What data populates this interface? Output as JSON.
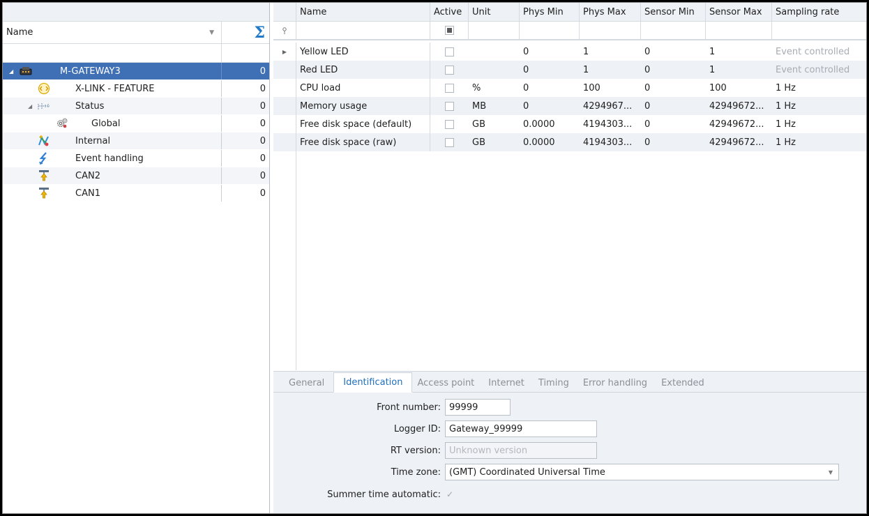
{
  "tree": {
    "header": {
      "name_label": "Name",
      "sum_symbol": "Σ"
    },
    "items": [
      {
        "label": "M-GATEWAY3",
        "count": "0",
        "level": 0,
        "expander": "◢",
        "icon": "gateway-icon",
        "selected": true
      },
      {
        "label": "X-LINK - FEATURE",
        "count": "0",
        "level": 1,
        "expander": "",
        "icon": "xlink-icon",
        "selected": false
      },
      {
        "label": "Status",
        "count": "0",
        "level": 1,
        "expander": "◢",
        "icon": "status-icon",
        "selected": false
      },
      {
        "label": "Global",
        "count": "0",
        "level": 2,
        "expander": "",
        "icon": "gears-icon",
        "selected": false
      },
      {
        "label": "Internal",
        "count": "0",
        "level": 1,
        "expander": "",
        "icon": "internal-icon",
        "selected": false
      },
      {
        "label": "Event handling",
        "count": "0",
        "level": 1,
        "expander": "",
        "icon": "event-icon",
        "selected": false
      },
      {
        "label": "CAN2",
        "count": "0",
        "level": 1,
        "expander": "",
        "icon": "can-icon",
        "selected": false
      },
      {
        "label": "CAN1",
        "count": "0",
        "level": 1,
        "expander": "",
        "icon": "can-icon",
        "selected": false
      }
    ]
  },
  "grid": {
    "columns": [
      "Name",
      "Active",
      "Unit",
      "Phys Min",
      "Phys Max",
      "Sensor Min",
      "Sensor Max",
      "Sampling rate"
    ],
    "rows": [
      {
        "name": "Yellow LED",
        "unit": "",
        "phys_min": "0",
        "phys_max": "1",
        "sensor_min": "0",
        "sensor_max": "1",
        "rate": "Event controlled",
        "rate_muted": true
      },
      {
        "name": "Red LED",
        "unit": "",
        "phys_min": "0",
        "phys_max": "1",
        "sensor_min": "0",
        "sensor_max": "1",
        "rate": "Event controlled",
        "rate_muted": true
      },
      {
        "name": "CPU load",
        "unit": "%",
        "phys_min": "0",
        "phys_max": "100",
        "sensor_min": "0",
        "sensor_max": "100",
        "rate": "1 Hz",
        "rate_muted": false
      },
      {
        "name": "Memory usage",
        "unit": "MB",
        "phys_min": "0",
        "phys_max": "4294967...",
        "sensor_min": "0",
        "sensor_max": "42949672...",
        "rate": "1 Hz",
        "rate_muted": false
      },
      {
        "name": "Free disk space (default)",
        "unit": "GB",
        "phys_min": "0.0000",
        "phys_max": "4194303...",
        "sensor_min": "0",
        "sensor_max": "42949672...",
        "rate": "1 Hz",
        "rate_muted": false
      },
      {
        "name": "Free disk space (raw)",
        "unit": "GB",
        "phys_min": "0.0000",
        "phys_max": "4194303...",
        "sensor_min": "0",
        "sensor_max": "42949672...",
        "rate": "1 Hz",
        "rate_muted": false
      }
    ]
  },
  "tabs": [
    "General",
    "Identification",
    "Access point",
    "Internet",
    "Timing",
    "Error handling",
    "Extended"
  ],
  "active_tab": "Identification",
  "form": {
    "front_number_label": "Front number:",
    "front_number_value": "99999",
    "logger_id_label": "Logger ID:",
    "logger_id_value": "Gateway_99999",
    "rt_version_label": "RT version:",
    "rt_version_placeholder": "Unknown version",
    "time_zone_label": "Time zone:",
    "time_zone_value": "(GMT) Coordinated Universal Time",
    "summer_time_label": "Summer time automatic:"
  },
  "colors": {
    "selection": "#3f6fb5",
    "accent": "#1e6fbf",
    "panel": "#eef1f5"
  }
}
